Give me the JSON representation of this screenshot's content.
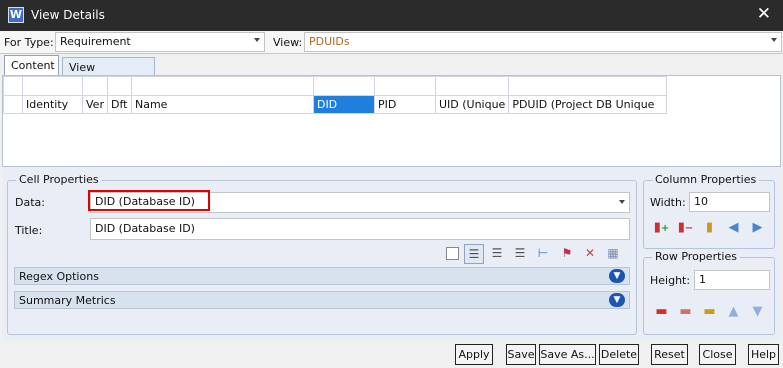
{
  "window": {
    "app_icon_letter": "W",
    "title": "View Details",
    "close_glyph": "✕"
  },
  "type_bar": {
    "for_type_label": "For Type:",
    "for_type_value": "Requirement",
    "view_label": "View:",
    "view_value": "PDUIDs"
  },
  "tabs": [
    {
      "label": "Content",
      "active": true
    },
    {
      "label": "View Properties",
      "active": false
    }
  ],
  "grid": {
    "columns": [
      "Identity",
      "Ver",
      "Dft",
      "Name",
      "DID",
      "PID",
      "UID (Unique",
      "PDUID (Project DB Unique"
    ],
    "selected_column": "DID",
    "colors": {
      "selected": "#1e7fdc"
    }
  },
  "cell_properties": {
    "title": "Cell Properties",
    "data_label": "Data:",
    "data_value": "DID (Database ID)",
    "title_label": "Title:",
    "title_value": "DID (Database ID)",
    "format_icons": [
      "color-swatch-icon",
      "align-left-icon",
      "align-center-icon",
      "align-right-icon",
      "insert-before-icon",
      "flag-icon",
      "clear-format-icon",
      "grid-icon"
    ],
    "regex_label": "Regex Options",
    "summary_label": "Summary Metrics",
    "highlight_color": "#e00000"
  },
  "column_properties": {
    "title": "Column Properties",
    "width_label": "Width:",
    "width_value": "10",
    "icons": [
      "add-column-icon",
      "remove-column-icon",
      "column-settings-icon",
      "move-left-icon",
      "move-right-icon"
    ]
  },
  "row_properties": {
    "title": "Row Properties",
    "height_label": "Height:",
    "height_value": "1",
    "icons": [
      "add-row-icon",
      "remove-row-icon",
      "row-settings-icon",
      "move-up-icon",
      "move-down-icon"
    ]
  },
  "buttons": {
    "apply": "Apply",
    "save": "Save",
    "save_as": "Save As...",
    "delete": "Delete",
    "reset": "Reset",
    "close": "Close",
    "help": "Help"
  }
}
